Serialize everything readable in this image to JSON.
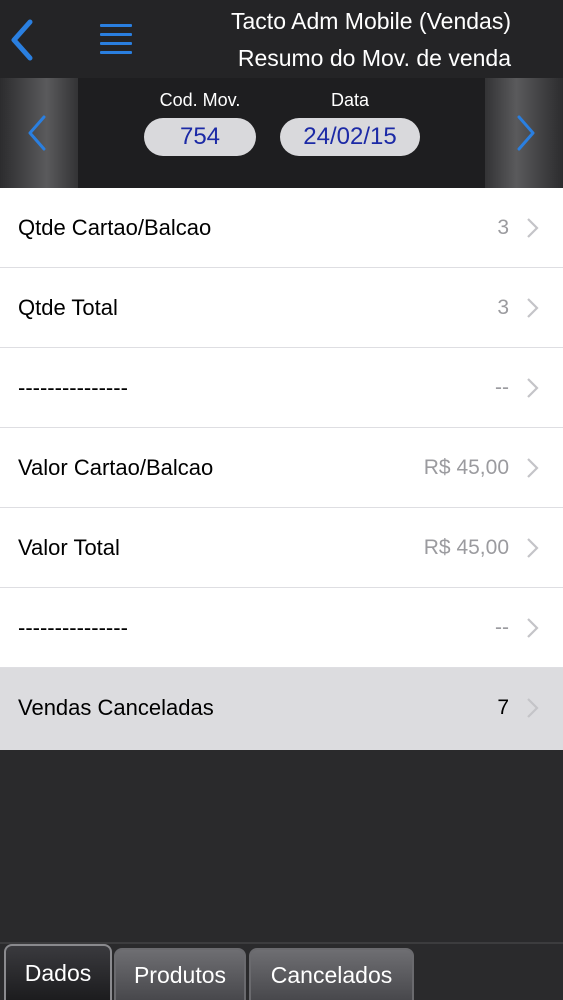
{
  "header": {
    "title": "Tacto Adm Mobile (Vendas)",
    "subtitle": "Resumo do Mov. de venda",
    "back_icon": "chevron-left-icon",
    "menu_icon": "hamburger-menu-icon"
  },
  "navigator": {
    "cod_label": "Cod. Mov.",
    "cod_value": "754",
    "data_label": "Data",
    "data_value": "24/02/15",
    "prev_icon": "chevron-left-icon",
    "next_icon": "chevron-right-icon"
  },
  "rows": [
    {
      "label": "Qtde Cartao/Balcao",
      "value": "3"
    },
    {
      "label": "Qtde Total",
      "value": "3"
    },
    {
      "label": "---------------",
      "value": "--"
    },
    {
      "label": "Valor Cartao/Balcao",
      "value": "R$ 45,00"
    },
    {
      "label": "Valor Total",
      "value": "R$ 45,00"
    },
    {
      "label": "---------------",
      "value": "--"
    },
    {
      "label": "Vendas Canceladas",
      "value": "7"
    }
  ],
  "tabs": [
    {
      "label": "Dados",
      "active": true
    },
    {
      "label": "Produtos",
      "active": false
    },
    {
      "label": "Cancelados",
      "active": false
    }
  ],
  "colors": {
    "accent": "#2a7fe0",
    "pill_text": "#1c2aa6",
    "background": "#2a2a2c"
  }
}
